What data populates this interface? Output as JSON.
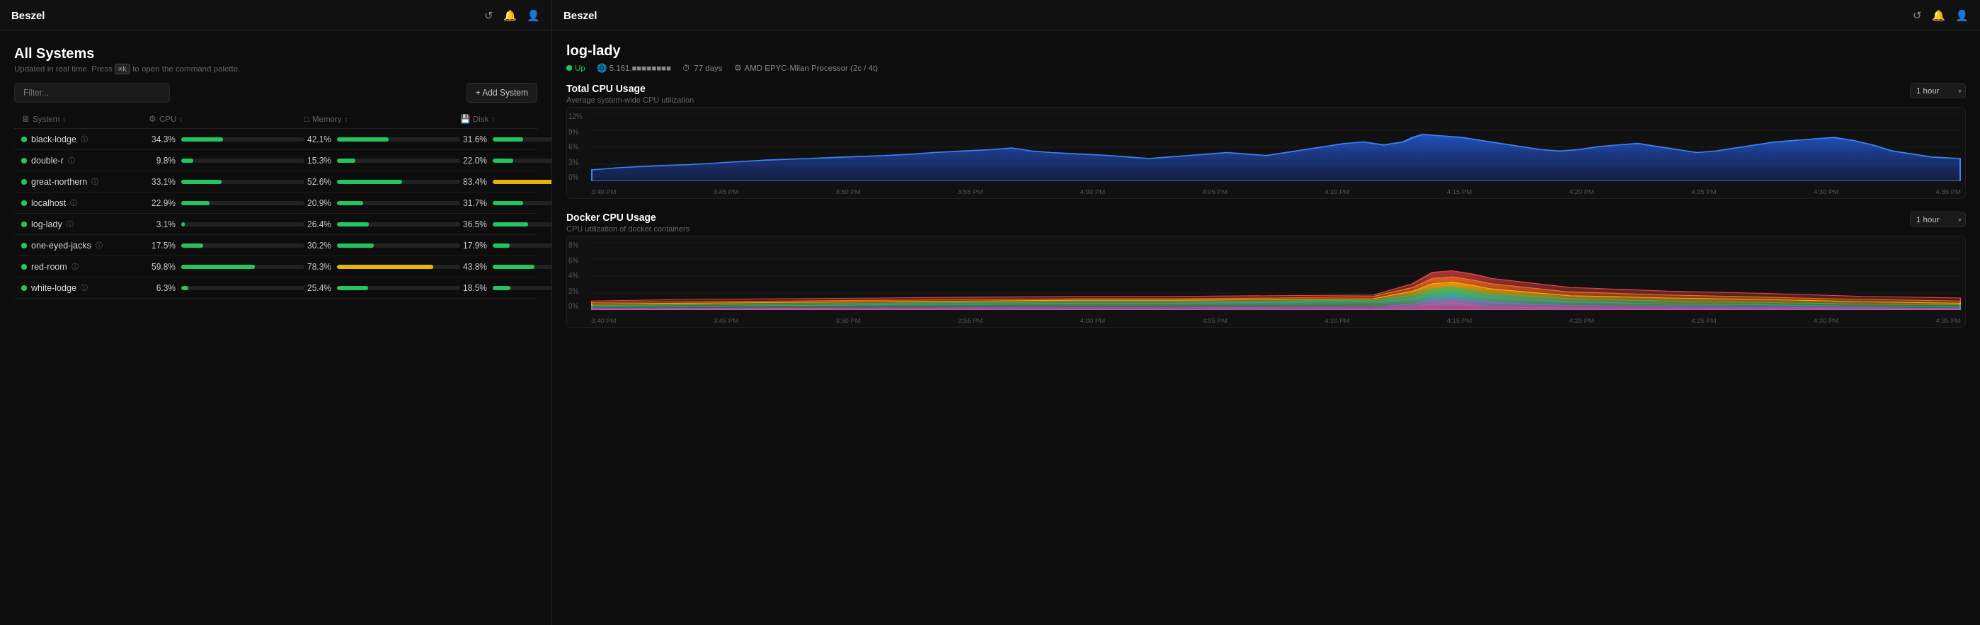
{
  "left_panel": {
    "topbar": {
      "title": "Beszel",
      "icons": [
        "refresh-icon",
        "notification-icon",
        "user-icon"
      ]
    },
    "page": {
      "title": "All Systems",
      "subtitle": "Updated in real time. Press",
      "kbd": "⌘k",
      "subtitle2": "to open the command palette."
    },
    "filter": {
      "placeholder": "Filter..."
    },
    "add_button": "+ Add System",
    "columns": [
      {
        "label": "System",
        "sort": true
      },
      {
        "label": "CPU",
        "sort": true
      },
      {
        "label": "Memory",
        "sort": true
      },
      {
        "label": "Disk",
        "sort": true
      }
    ],
    "rows": [
      {
        "name": "black-lodge",
        "cpu_val": "34.3%",
        "cpu_pct": 34,
        "cpu_color": "green",
        "mem_val": "42.1%",
        "mem_pct": 42,
        "mem_color": "green",
        "disk_val": "31.6%",
        "disk_pct": 32,
        "disk_color": "green"
      },
      {
        "name": "double-r",
        "cpu_val": "9.8%",
        "cpu_pct": 10,
        "cpu_color": "green",
        "mem_val": "15.3%",
        "mem_pct": 15,
        "mem_color": "green",
        "disk_val": "22.0%",
        "disk_pct": 22,
        "disk_color": "green"
      },
      {
        "name": "great-northern",
        "cpu_val": "33.1%",
        "cpu_pct": 33,
        "cpu_color": "green",
        "mem_val": "52.6%",
        "mem_pct": 53,
        "mem_color": "green",
        "disk_val": "83.4%",
        "disk_pct": 83,
        "disk_color": "yellow"
      },
      {
        "name": "localhost",
        "cpu_val": "22.9%",
        "cpu_pct": 23,
        "cpu_color": "green",
        "mem_val": "20.9%",
        "mem_pct": 21,
        "mem_color": "green",
        "disk_val": "31.7%",
        "disk_pct": 32,
        "disk_color": "green"
      },
      {
        "name": "log-lady",
        "cpu_val": "3.1%",
        "cpu_pct": 3,
        "cpu_color": "green",
        "mem_val": "26.4%",
        "mem_pct": 26,
        "mem_color": "green",
        "disk_val": "36.5%",
        "disk_pct": 37,
        "disk_color": "green"
      },
      {
        "name": "one-eyed-jacks",
        "cpu_val": "17.5%",
        "cpu_pct": 18,
        "cpu_color": "green",
        "mem_val": "30.2%",
        "mem_pct": 30,
        "mem_color": "green",
        "disk_val": "17.9%",
        "disk_pct": 18,
        "disk_color": "green"
      },
      {
        "name": "red-room",
        "cpu_val": "59.8%",
        "cpu_pct": 60,
        "cpu_color": "green",
        "mem_val": "78.3%",
        "mem_pct": 78,
        "mem_color": "yellow",
        "disk_val": "43.8%",
        "disk_pct": 44,
        "disk_color": "green"
      },
      {
        "name": "white-lodge",
        "cpu_val": "6.3%",
        "cpu_pct": 6,
        "cpu_color": "green",
        "mem_val": "25.4%",
        "mem_pct": 25,
        "mem_color": "green",
        "disk_val": "18.5%",
        "disk_pct": 19,
        "disk_color": "green"
      }
    ]
  },
  "right_panel": {
    "topbar": {
      "title": "Beszel"
    },
    "system": {
      "name": "log-lady",
      "status": "Up",
      "ip": "5.161.■■■■■■■■",
      "uptime": "77 days",
      "cpu": "AMD EPYC-Milan Processor (2c / 4t)"
    },
    "charts": [
      {
        "id": "total-cpu",
        "title": "Total CPU Usage",
        "subtitle": "Average system-wide CPU utilization",
        "time_label": "1 hour",
        "y_labels": [
          "12%",
          "9%",
          "6%",
          "3%",
          "0%"
        ],
        "x_labels": [
          "3:40 PM",
          "3:45 PM",
          "3:50 PM",
          "3:55 PM",
          "4:00 PM",
          "4:05 PM",
          "4:10 PM",
          "4:15 PM",
          "4:20 PM",
          "4:25 PM",
          "4:30 PM",
          "4:35 PM"
        ],
        "color": "#2563eb"
      },
      {
        "id": "docker-cpu",
        "title": "Docker CPU Usage",
        "subtitle": "CPU utilization of docker containers",
        "time_label": "1 hour",
        "y_labels": [
          "8%",
          "6%",
          "4%",
          "2%",
          "0%"
        ],
        "x_labels": [
          "3:40 PM",
          "3:45 PM",
          "3:50 PM",
          "3:55 PM",
          "4:00 PM",
          "4:05 PM",
          "4:10 PM",
          "4:15 PM",
          "4:20 PM",
          "4:25 PM",
          "4:30 PM",
          "4:35 PM"
        ],
        "color": "multicolor"
      }
    ]
  }
}
